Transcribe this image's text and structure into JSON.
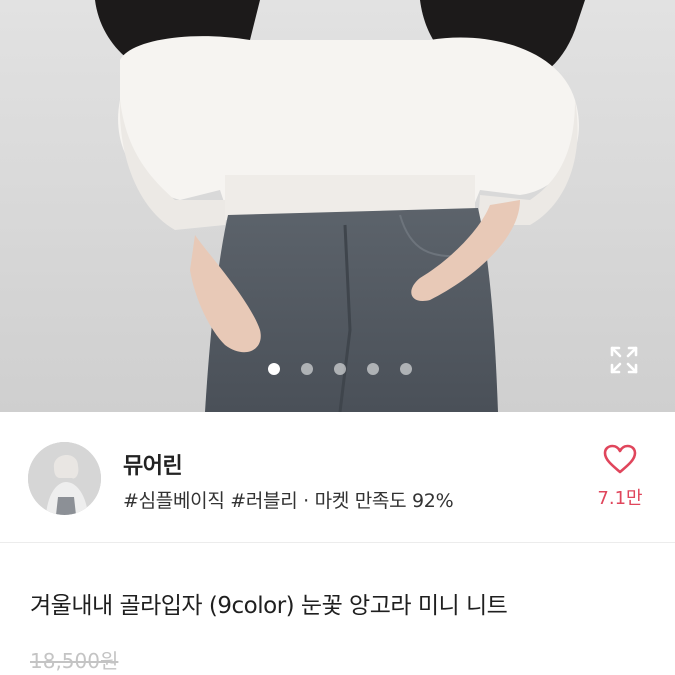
{
  "carousel": {
    "dots": [
      true,
      false,
      false,
      false,
      false
    ],
    "expand_icon": "expand-icon"
  },
  "seller": {
    "name": "뮤어린",
    "tags": "#심플베이직 #러블리 · 마켓 만족도 92%",
    "like_count": "7.1만",
    "like_icon": "heart-outline-icon",
    "accent_color": "#e0465c"
  },
  "product": {
    "title": "겨울내내 골라입자 (9color) 눈꽃 앙고라 미니 니트",
    "original_price": "18,500원"
  }
}
